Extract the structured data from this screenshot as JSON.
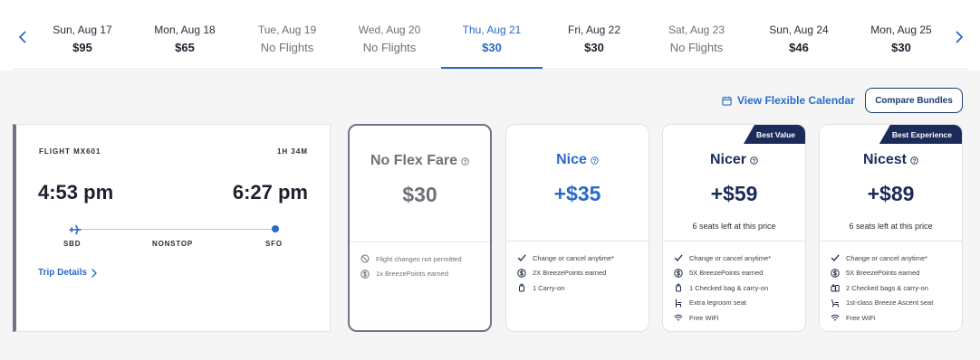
{
  "colors": {
    "accent": "#2a6ac7",
    "navy": "#1c2b5a",
    "muted": "#6e707a",
    "badge": "#1c2b5a"
  },
  "date_nav": {
    "prev_icon": "chevron-left-icon",
    "next_icon": "chevron-right-icon",
    "days": [
      {
        "label": "Sun, Aug 17",
        "price": "$95",
        "available": true,
        "selected": false
      },
      {
        "label": "Mon, Aug 18",
        "price": "$65",
        "available": true,
        "selected": false
      },
      {
        "label": "Tue, Aug 19",
        "price": "No Flights",
        "available": false,
        "selected": false
      },
      {
        "label": "Wed, Aug 20",
        "price": "No Flights",
        "available": false,
        "selected": false
      },
      {
        "label": "Thu, Aug 21",
        "price": "$30",
        "available": true,
        "selected": true
      },
      {
        "label": "Fri, Aug 22",
        "price": "$30",
        "available": true,
        "selected": false
      },
      {
        "label": "Sat, Aug 23",
        "price": "No Flights",
        "available": false,
        "selected": false
      },
      {
        "label": "Sun, Aug 24",
        "price": "$46",
        "available": true,
        "selected": false
      },
      {
        "label": "Mon, Aug 25",
        "price": "$30",
        "available": true,
        "selected": false
      }
    ]
  },
  "actions": {
    "flexible_calendar": "View Flexible Calendar",
    "compare_bundles": "Compare Bundles"
  },
  "flight": {
    "number": "FLIGHT MX601",
    "duration": "1H 34M",
    "depart_time": "4:53 pm",
    "arrive_time": "6:27 pm",
    "origin": "SBD",
    "stops": "NONSTOP",
    "destination": "SFO",
    "trip_details": "Trip Details"
  },
  "bundles": [
    {
      "name": "No Flex Fare",
      "price": "$30",
      "seats": "",
      "badge": "",
      "tone": "grey",
      "selected": true,
      "features": [
        {
          "icon": "no-sign-icon",
          "text": "Flight changes not permitted"
        },
        {
          "icon": "dollar-coin-icon",
          "text": "1x BreezePoints earned"
        }
      ]
    },
    {
      "name": "Nice",
      "price": "+$35",
      "seats": "",
      "badge": "",
      "tone": "blue",
      "selected": false,
      "features": [
        {
          "icon": "check-icon",
          "text": "Change or cancel anytime*"
        },
        {
          "icon": "dollar-coin-icon",
          "text": "2X BreezePoints earned"
        },
        {
          "icon": "carry-on-icon",
          "text": "1 Carry-on"
        }
      ]
    },
    {
      "name": "Nicer",
      "price": "+$59",
      "seats": "6 seats left at this price",
      "badge": "Best Value",
      "tone": "navy",
      "selected": false,
      "features": [
        {
          "icon": "check-icon",
          "text": "Change or cancel anytime*"
        },
        {
          "icon": "dollar-coin-icon",
          "text": "5X BreezePoints earned"
        },
        {
          "icon": "carry-on-icon",
          "text": "1 Checked bag & carry-on"
        },
        {
          "icon": "seat-icon",
          "text": "Extra legroom seat"
        },
        {
          "icon": "wifi-icon",
          "text": "Free WiFi"
        }
      ]
    },
    {
      "name": "Nicest",
      "price": "+$89",
      "seats": "6 seats left at this price",
      "badge": "Best Experience",
      "tone": "navy",
      "selected": false,
      "features": [
        {
          "icon": "check-icon",
          "text": "Change or cancel anytime*"
        },
        {
          "icon": "dollar-coin-icon",
          "text": "5X BreezePoints earned"
        },
        {
          "icon": "bags-icon",
          "text": "2 Checked bags & carry-on"
        },
        {
          "icon": "recliner-seat-icon",
          "text": "1st-class Breeze Ascent seat"
        },
        {
          "icon": "wifi-icon",
          "text": "Free WiFi"
        }
      ]
    }
  ]
}
